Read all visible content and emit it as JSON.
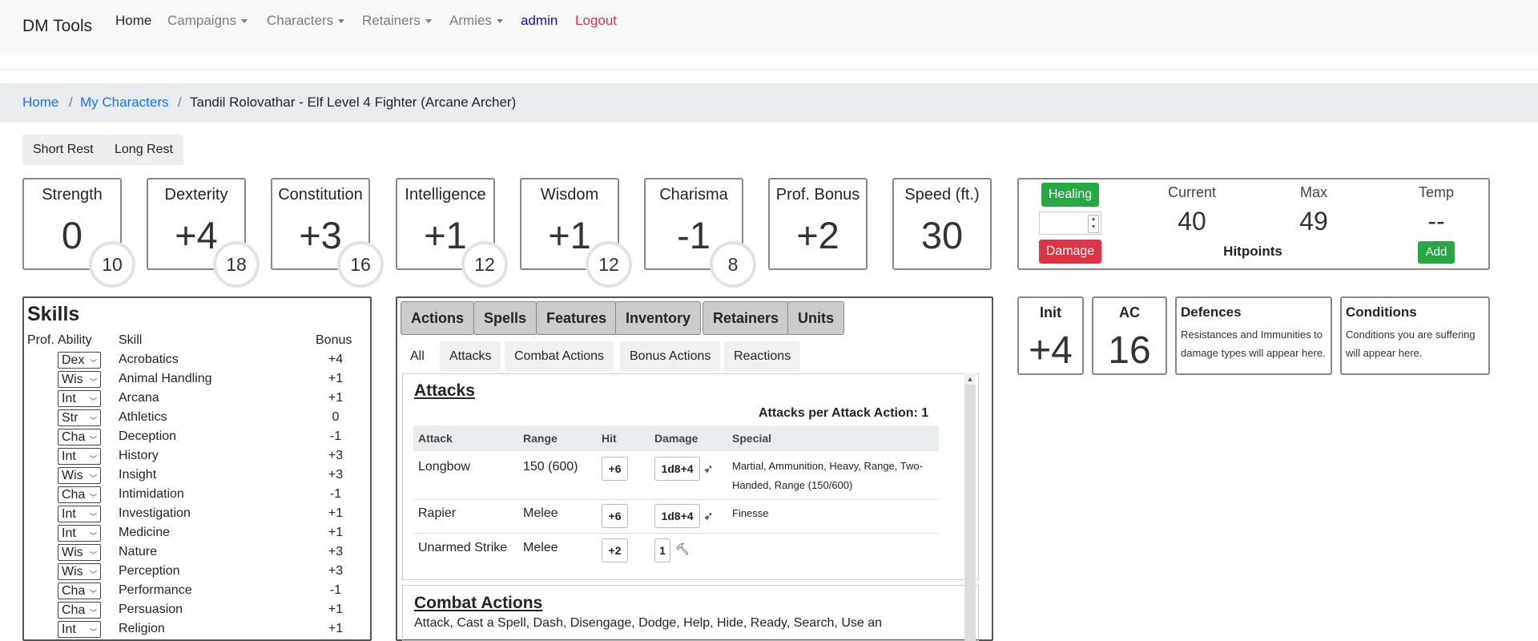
{
  "nav": {
    "brand": "DM Tools",
    "home": "Home",
    "campaigns": "Campaigns",
    "characters": "Characters",
    "retainers": "Retainers",
    "armies": "Armies",
    "admin": "admin",
    "logout": "Logout"
  },
  "breadcrumb": {
    "home": "Home",
    "sep": "/",
    "my_characters": "My Characters",
    "current": "Tandil Rolovathar - Elf Level 4 Fighter (Arcane Archer)"
  },
  "rest": {
    "short": "Short Rest",
    "long": "Long Rest"
  },
  "abilities": [
    {
      "label": "Strength",
      "mod": "0",
      "score": "10"
    },
    {
      "label": "Dexterity",
      "mod": "+4",
      "score": "18"
    },
    {
      "label": "Constitution",
      "mod": "+3",
      "score": "16"
    },
    {
      "label": "Intelligence",
      "mod": "+1",
      "score": "12"
    },
    {
      "label": "Wisdom",
      "mod": "+1",
      "score": "12"
    },
    {
      "label": "Charisma",
      "mod": "-1",
      "score": "8"
    }
  ],
  "prof_bonus": {
    "label": "Prof. Bonus",
    "value": "+2"
  },
  "speed": {
    "label": "Speed (ft.)",
    "value": "30"
  },
  "hp": {
    "healing": "Healing",
    "damage": "Damage",
    "current_label": "Current",
    "current": "40",
    "max_label": "Max",
    "max": "49",
    "temp_label": "Temp",
    "temp": "--",
    "add": "Add",
    "title": "Hitpoints"
  },
  "skills": {
    "title": "Skills",
    "headers": {
      "prof": "Prof.",
      "ability": "Ability",
      "skill": "Skill",
      "bonus": "Bonus"
    },
    "rows": [
      {
        "ability": "Dex",
        "name": "Acrobatics",
        "bonus": "+4"
      },
      {
        "ability": "Wis",
        "name": "Animal Handling",
        "bonus": "+1"
      },
      {
        "ability": "Int",
        "name": "Arcana",
        "bonus": "+1"
      },
      {
        "ability": "Str",
        "name": "Athletics",
        "bonus": "0"
      },
      {
        "ability": "Cha",
        "name": "Deception",
        "bonus": "-1"
      },
      {
        "ability": "Int",
        "name": "History",
        "bonus": "+3"
      },
      {
        "ability": "Wis",
        "name": "Insight",
        "bonus": "+3"
      },
      {
        "ability": "Cha",
        "name": "Intimidation",
        "bonus": "-1"
      },
      {
        "ability": "Int",
        "name": "Investigation",
        "bonus": "+1"
      },
      {
        "ability": "Int",
        "name": "Medicine",
        "bonus": "+1"
      },
      {
        "ability": "Wis",
        "name": "Nature",
        "bonus": "+3"
      },
      {
        "ability": "Wis",
        "name": "Perception",
        "bonus": "+3"
      },
      {
        "ability": "Cha",
        "name": "Performance",
        "bonus": "-1"
      },
      {
        "ability": "Cha",
        "name": "Persuasion",
        "bonus": "+1"
      },
      {
        "ability": "Int",
        "name": "Religion",
        "bonus": "+1"
      }
    ]
  },
  "tabs": [
    "Actions",
    "Spells",
    "Features",
    "Inventory",
    "Retainers",
    "Units"
  ],
  "subtabs": [
    "All",
    "Attacks",
    "Combat Actions",
    "Bonus Actions",
    "Reactions"
  ],
  "attacks": {
    "title": "Attacks",
    "per_action": "Attacks per Attack Action: 1",
    "headers": {
      "attack": "Attack",
      "range": "Range",
      "hit": "Hit",
      "damage": "Damage",
      "special": "Special"
    },
    "rows": [
      {
        "attack": "Longbow",
        "range": "150 (600)",
        "hit": "+6",
        "damage": "1d8+4",
        "special": "Martial, Ammunition, Heavy, Range, Two-Handed, Range (150/600)"
      },
      {
        "attack": "Rapier",
        "range": "Melee",
        "hit": "+6",
        "damage": "1d8+4",
        "special": "Finesse"
      },
      {
        "attack": "Unarmed Strike",
        "range": "Melee",
        "hit": "+2",
        "damage": "1",
        "special": ""
      }
    ]
  },
  "combat_actions": {
    "title": "Combat Actions",
    "text": "Attack, Cast a Spell, Dash, Disengage, Dodge, Help, Hide, Ready, Search, Use an"
  },
  "init": {
    "label": "Init",
    "value": "+4"
  },
  "ac": {
    "label": "AC",
    "value": "16"
  },
  "defences": {
    "title": "Defences",
    "text": "Resistances and Immunities to damage types will appear here."
  },
  "conditions": {
    "title": "Conditions",
    "text": "Conditions you are suffering will appear here."
  },
  "colors": {
    "green": "#28a745",
    "red": "#dc3545",
    "link": "#1e73e8"
  }
}
